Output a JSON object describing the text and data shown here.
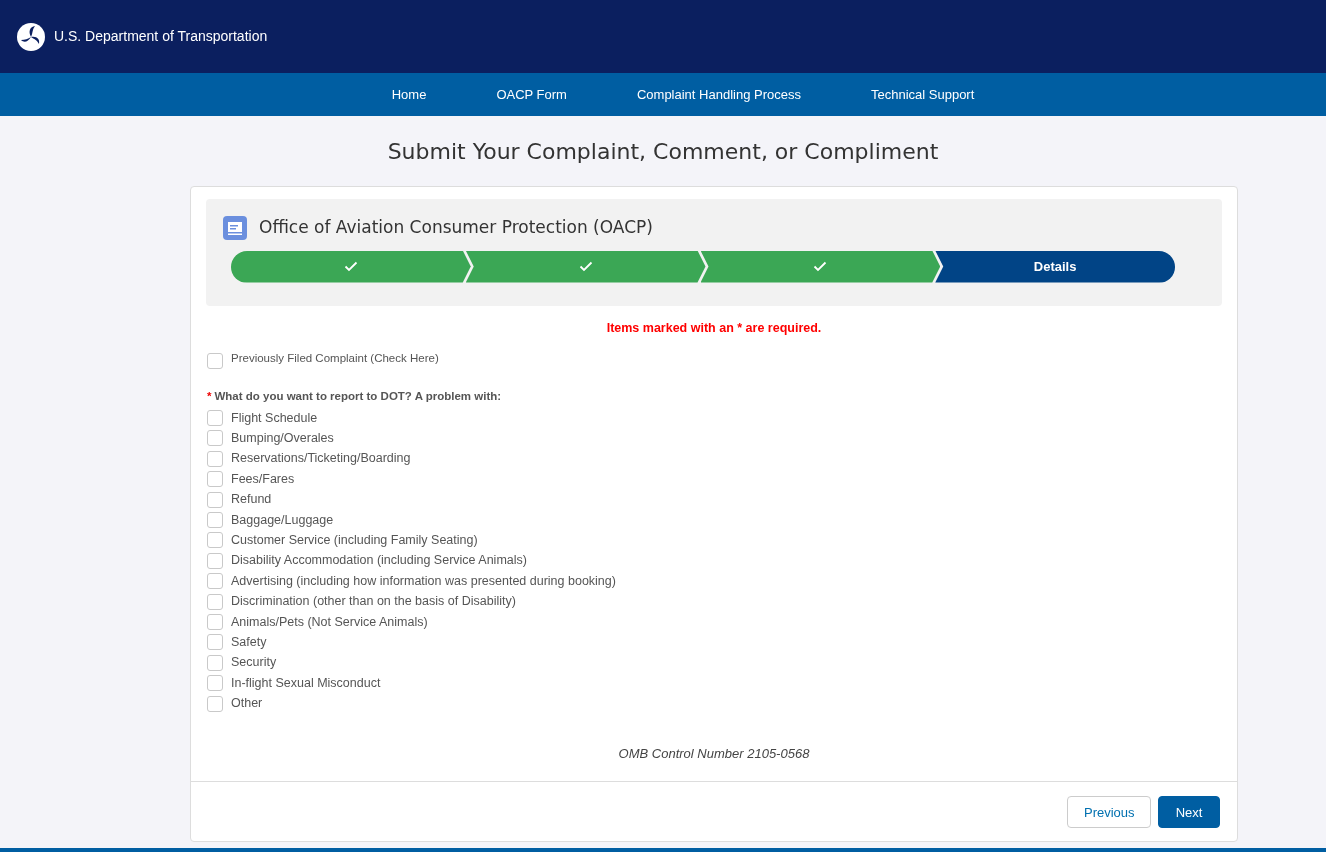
{
  "header": {
    "agency": "U.S. Department of Transportation"
  },
  "nav": [
    {
      "label": "Home"
    },
    {
      "label": "OACP Form"
    },
    {
      "label": "Complaint Handling Process"
    },
    {
      "label": "Technical Support"
    }
  ],
  "page_title": "Submit Your Complaint, Comment, or Compliment",
  "form": {
    "title": "Office of Aviation Consumer Protection (OACP)",
    "steps": [
      {
        "completed": true,
        "selected": false
      },
      {
        "completed": true,
        "selected": false
      },
      {
        "completed": true,
        "selected": false
      },
      {
        "label": "Details",
        "completed": false,
        "selected": true
      }
    ],
    "required_note": "Items marked with an * are required.",
    "previously_filed": {
      "label": "Previously Filed Complaint (Check Here)",
      "checked": false
    },
    "question": {
      "required_mark": "*",
      "label": "What do you want to report to DOT? A problem with:"
    },
    "options": [
      {
        "label": "Flight Schedule",
        "checked": false
      },
      {
        "label": "Bumping/Overales",
        "checked": false
      },
      {
        "label": "Reservations/Ticketing/Boarding",
        "checked": false
      },
      {
        "label": "Fees/Fares",
        "checked": false
      },
      {
        "label": "Refund",
        "checked": false
      },
      {
        "label": "Baggage/Luggage",
        "checked": false
      },
      {
        "label": "Customer Service (including Family Seating)",
        "checked": false
      },
      {
        "label": "Disability Accommodation (including Service Animals)",
        "checked": false
      },
      {
        "label": "Advertising (including how information was presented during booking)",
        "checked": false
      },
      {
        "label": "Discrimination (other than on the basis of Disability)",
        "checked": false
      },
      {
        "label": "Animals/Pets (Not Service Animals)",
        "checked": false
      },
      {
        "label": "Safety",
        "checked": false
      },
      {
        "label": "Security",
        "checked": false
      },
      {
        "label": "In-flight Sexual Misconduct",
        "checked": false
      },
      {
        "label": "Other",
        "checked": false
      }
    ],
    "omb": "OMB Control Number 2105-0568",
    "buttons": [
      {
        "label": "Previous",
        "kind": "secondary"
      },
      {
        "label": "Next",
        "kind": "primary"
      }
    ]
  }
}
